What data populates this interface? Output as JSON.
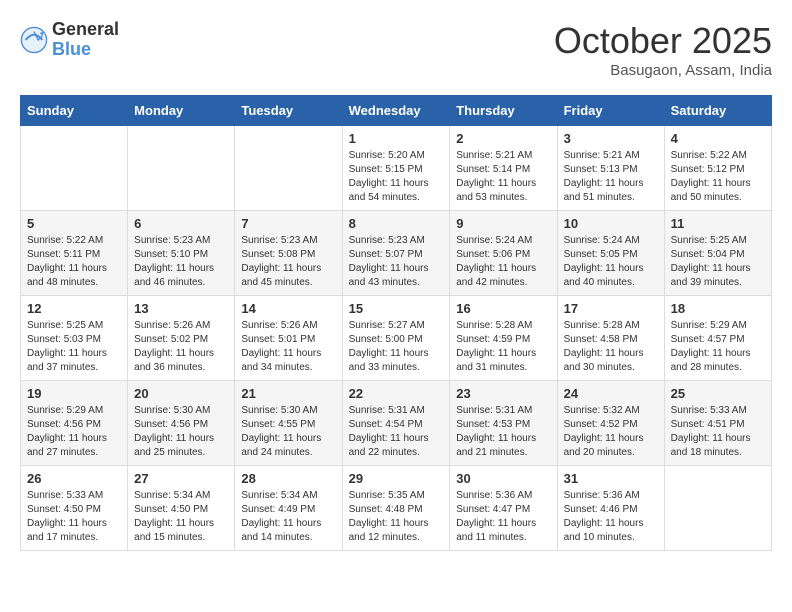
{
  "logo": {
    "general": "General",
    "blue": "Blue"
  },
  "header": {
    "month": "October 2025",
    "location": "Basugaon, Assam, India"
  },
  "weekdays": [
    "Sunday",
    "Monday",
    "Tuesday",
    "Wednesday",
    "Thursday",
    "Friday",
    "Saturday"
  ],
  "weeks": [
    [
      {
        "day": "",
        "info": ""
      },
      {
        "day": "",
        "info": ""
      },
      {
        "day": "",
        "info": ""
      },
      {
        "day": "1",
        "info": "Sunrise: 5:20 AM\nSunset: 5:15 PM\nDaylight: 11 hours\nand 54 minutes."
      },
      {
        "day": "2",
        "info": "Sunrise: 5:21 AM\nSunset: 5:14 PM\nDaylight: 11 hours\nand 53 minutes."
      },
      {
        "day": "3",
        "info": "Sunrise: 5:21 AM\nSunset: 5:13 PM\nDaylight: 11 hours\nand 51 minutes."
      },
      {
        "day": "4",
        "info": "Sunrise: 5:22 AM\nSunset: 5:12 PM\nDaylight: 11 hours\nand 50 minutes."
      }
    ],
    [
      {
        "day": "5",
        "info": "Sunrise: 5:22 AM\nSunset: 5:11 PM\nDaylight: 11 hours\nand 48 minutes."
      },
      {
        "day": "6",
        "info": "Sunrise: 5:23 AM\nSunset: 5:10 PM\nDaylight: 11 hours\nand 46 minutes."
      },
      {
        "day": "7",
        "info": "Sunrise: 5:23 AM\nSunset: 5:08 PM\nDaylight: 11 hours\nand 45 minutes."
      },
      {
        "day": "8",
        "info": "Sunrise: 5:23 AM\nSunset: 5:07 PM\nDaylight: 11 hours\nand 43 minutes."
      },
      {
        "day": "9",
        "info": "Sunrise: 5:24 AM\nSunset: 5:06 PM\nDaylight: 11 hours\nand 42 minutes."
      },
      {
        "day": "10",
        "info": "Sunrise: 5:24 AM\nSunset: 5:05 PM\nDaylight: 11 hours\nand 40 minutes."
      },
      {
        "day": "11",
        "info": "Sunrise: 5:25 AM\nSunset: 5:04 PM\nDaylight: 11 hours\nand 39 minutes."
      }
    ],
    [
      {
        "day": "12",
        "info": "Sunrise: 5:25 AM\nSunset: 5:03 PM\nDaylight: 11 hours\nand 37 minutes."
      },
      {
        "day": "13",
        "info": "Sunrise: 5:26 AM\nSunset: 5:02 PM\nDaylight: 11 hours\nand 36 minutes."
      },
      {
        "day": "14",
        "info": "Sunrise: 5:26 AM\nSunset: 5:01 PM\nDaylight: 11 hours\nand 34 minutes."
      },
      {
        "day": "15",
        "info": "Sunrise: 5:27 AM\nSunset: 5:00 PM\nDaylight: 11 hours\nand 33 minutes."
      },
      {
        "day": "16",
        "info": "Sunrise: 5:28 AM\nSunset: 4:59 PM\nDaylight: 11 hours\nand 31 minutes."
      },
      {
        "day": "17",
        "info": "Sunrise: 5:28 AM\nSunset: 4:58 PM\nDaylight: 11 hours\nand 30 minutes."
      },
      {
        "day": "18",
        "info": "Sunrise: 5:29 AM\nSunset: 4:57 PM\nDaylight: 11 hours\nand 28 minutes."
      }
    ],
    [
      {
        "day": "19",
        "info": "Sunrise: 5:29 AM\nSunset: 4:56 PM\nDaylight: 11 hours\nand 27 minutes."
      },
      {
        "day": "20",
        "info": "Sunrise: 5:30 AM\nSunset: 4:56 PM\nDaylight: 11 hours\nand 25 minutes."
      },
      {
        "day": "21",
        "info": "Sunrise: 5:30 AM\nSunset: 4:55 PM\nDaylight: 11 hours\nand 24 minutes."
      },
      {
        "day": "22",
        "info": "Sunrise: 5:31 AM\nSunset: 4:54 PM\nDaylight: 11 hours\nand 22 minutes."
      },
      {
        "day": "23",
        "info": "Sunrise: 5:31 AM\nSunset: 4:53 PM\nDaylight: 11 hours\nand 21 minutes."
      },
      {
        "day": "24",
        "info": "Sunrise: 5:32 AM\nSunset: 4:52 PM\nDaylight: 11 hours\nand 20 minutes."
      },
      {
        "day": "25",
        "info": "Sunrise: 5:33 AM\nSunset: 4:51 PM\nDaylight: 11 hours\nand 18 minutes."
      }
    ],
    [
      {
        "day": "26",
        "info": "Sunrise: 5:33 AM\nSunset: 4:50 PM\nDaylight: 11 hours\nand 17 minutes."
      },
      {
        "day": "27",
        "info": "Sunrise: 5:34 AM\nSunset: 4:50 PM\nDaylight: 11 hours\nand 15 minutes."
      },
      {
        "day": "28",
        "info": "Sunrise: 5:34 AM\nSunset: 4:49 PM\nDaylight: 11 hours\nand 14 minutes."
      },
      {
        "day": "29",
        "info": "Sunrise: 5:35 AM\nSunset: 4:48 PM\nDaylight: 11 hours\nand 12 minutes."
      },
      {
        "day": "30",
        "info": "Sunrise: 5:36 AM\nSunset: 4:47 PM\nDaylight: 11 hours\nand 11 minutes."
      },
      {
        "day": "31",
        "info": "Sunrise: 5:36 AM\nSunset: 4:46 PM\nDaylight: 11 hours\nand 10 minutes."
      },
      {
        "day": "",
        "info": ""
      }
    ]
  ]
}
